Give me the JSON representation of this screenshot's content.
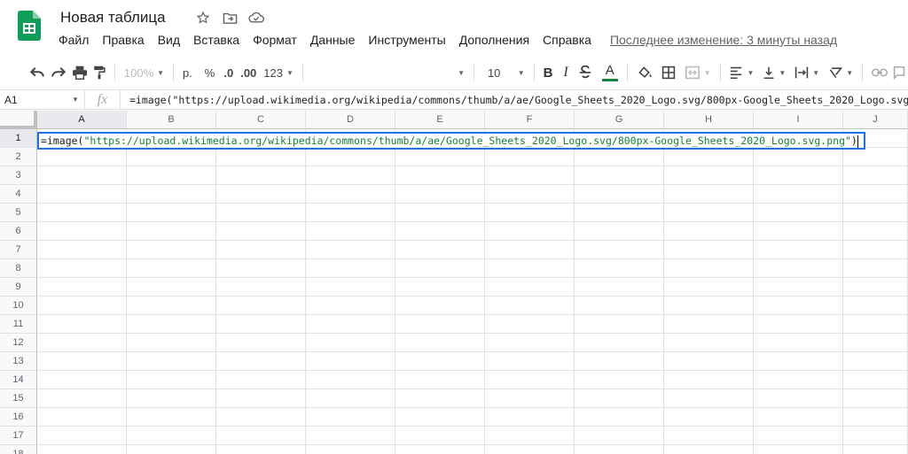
{
  "app": {
    "doc_title": "Новая таблица",
    "icons": [
      "star-icon",
      "move-to-folder-icon",
      "cloud-status-icon"
    ],
    "brand_color": "#0f9d58"
  },
  "menu": {
    "items": [
      "Файл",
      "Правка",
      "Вид",
      "Вставка",
      "Формат",
      "Данные",
      "Инструменты",
      "Дополнения",
      "Справка"
    ],
    "last_edit": "Последнее изменение: 3 минуты назад"
  },
  "toolbar": {
    "zoom": "100%",
    "currency": "р.",
    "percent": "%",
    "decrease_decimals": ".0",
    "increase_decimals": ".00",
    "more_formats": "123",
    "font_size": "10",
    "bold": "B",
    "italic": "I",
    "text_color_letter": "A",
    "text_color": "#188038"
  },
  "formula_bar": {
    "cell_ref": "A1",
    "fx": "fx",
    "content": "=image(\"https://upload.wikimedia.org/wikipedia/commons/thumb/a/ae/Google_Sheets_2020_Logo.svg/800px-Google_Sheets_2020_Logo.svg.png\")"
  },
  "grid": {
    "columns": [
      "A",
      "B",
      "C",
      "D",
      "E",
      "F",
      "G",
      "H",
      "I",
      "J"
    ],
    "rows": [
      "1",
      "2",
      "3",
      "4",
      "5",
      "6",
      "7",
      "8",
      "9",
      "10",
      "11",
      "12",
      "13",
      "14",
      "15",
      "16",
      "17",
      "18"
    ],
    "selected_cell": "A1",
    "editor": {
      "fn": "=image(",
      "arg": "\"https://upload.wikimedia.org/wikipedia/commons/thumb/a/ae/Google_Sheets_2020_Logo.svg/800px-Google_Sheets_2020_Logo.svg.png\"",
      "close": ")"
    },
    "selection_color": "#1a73e8"
  }
}
